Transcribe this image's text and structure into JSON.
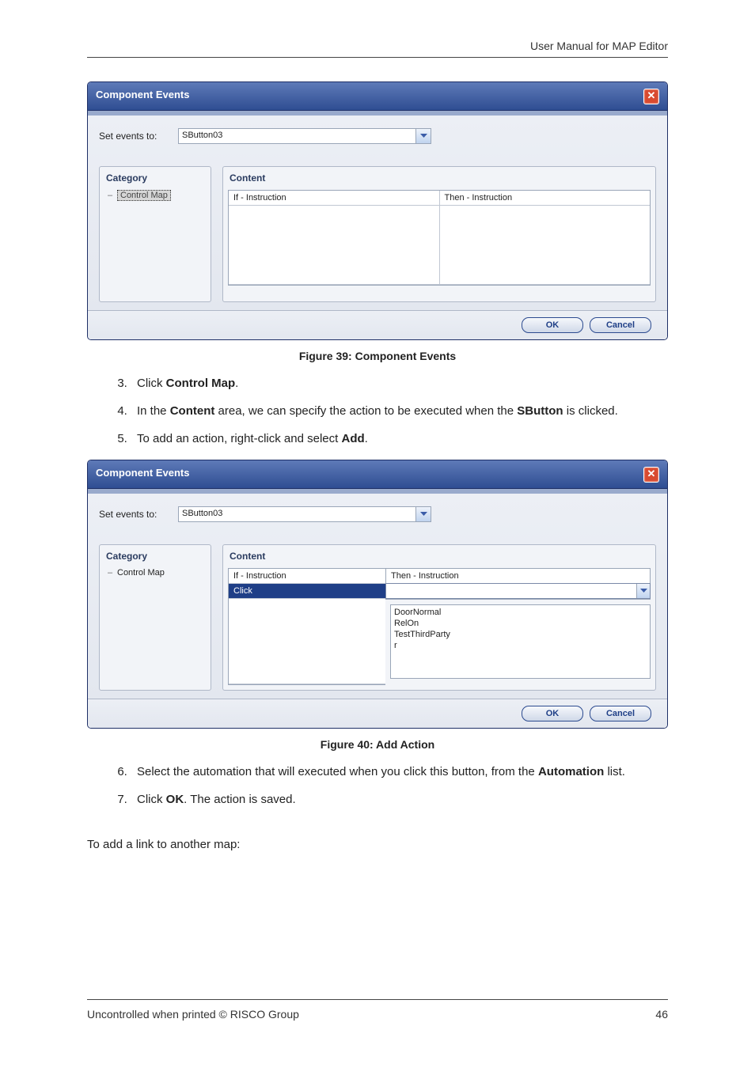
{
  "header": {
    "title": "User Manual for MAP Editor"
  },
  "footer": {
    "left": "Uncontrolled when printed © RISCO Group",
    "page": "46"
  },
  "dialog1": {
    "title": "Component Events",
    "setLabel": "Set events to:",
    "setValue": "SButton03",
    "categoryHead": "Category",
    "categoryItem": "Control Map",
    "contentHead": "Content",
    "col1": "If - Instruction",
    "col2": "Then - Instruction",
    "ok": "OK",
    "cancel": "Cancel"
  },
  "figcap1": "Figure 39: Component Events",
  "steps1": {
    "s3a": "Click ",
    "s3b": "Control Map",
    "s3c": ".",
    "s4a": "In the ",
    "s4b": "Content",
    "s4c": " area, we can specify the action to be executed when the ",
    "s4d": "SButton",
    "s4e": " is clicked.",
    "s5a": "To add an action, right-click and select ",
    "s5b": "Add",
    "s5c": "."
  },
  "dialog2": {
    "title": "Component Events",
    "setLabel": "Set events to:",
    "setValue": "SButton03",
    "categoryHead": "Category",
    "categoryItem": "Control Map",
    "contentHead": "Content",
    "col1": "If - Instruction",
    "col2": "Then - Instruction",
    "click": "Click",
    "listItems": [
      "DoorNormal",
      "RelOn",
      "TestThirdParty",
      "r"
    ],
    "ok": "OK",
    "cancel": "Cancel"
  },
  "figcap2": "Figure 40: Add Action",
  "steps2": {
    "s6a": "Select the automation that will executed when you click this button, from the ",
    "s6b": "Automation",
    "s6c": " list.",
    "s7a": "Click ",
    "s7b": "OK",
    "s7c": ". The action is saved."
  },
  "para": "To add a link to another map:"
}
